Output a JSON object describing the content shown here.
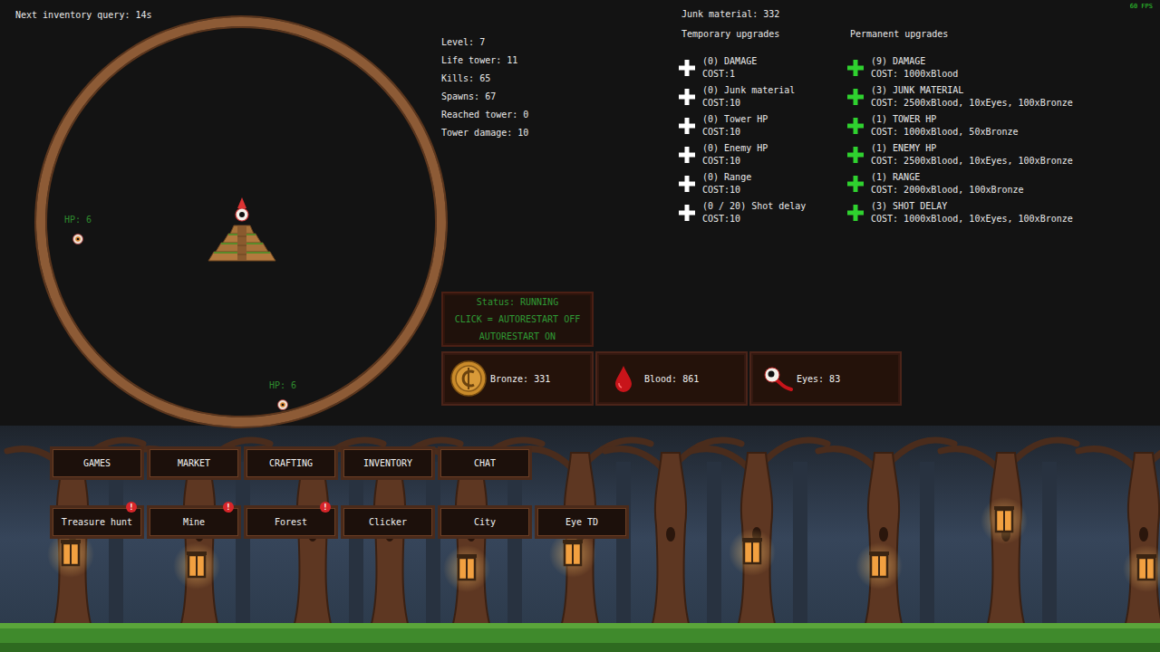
{
  "hud": {
    "inventory_query": "Next inventory query: 14s",
    "fps": "60 FPS"
  },
  "arena": {
    "enemies": [
      {
        "hp": "HP: 6"
      },
      {
        "hp": "HP: 6"
      }
    ]
  },
  "stats": [
    "Level: 7",
    "Life tower: 11",
    "Kills: 65",
    "Spawns: 67",
    "Reached tower: 0",
    "Tower damage: 10"
  ],
  "junk_material": "Junk material: 332",
  "temporary_upgrades": {
    "title": "Temporary upgrades",
    "items": [
      {
        "name": "(0) DAMAGE",
        "cost": "COST:1"
      },
      {
        "name": "(0) Junk material",
        "cost": "COST:10"
      },
      {
        "name": "(0) Tower HP",
        "cost": "COST:10"
      },
      {
        "name": "(0) Enemy HP",
        "cost": "COST:10"
      },
      {
        "name": "(0) Range",
        "cost": "COST:10"
      },
      {
        "name": "(0 / 20) Shot delay",
        "cost": "COST:10"
      }
    ]
  },
  "permanent_upgrades": {
    "title": "Permanent upgrades",
    "items": [
      {
        "name": "(9) DAMAGE",
        "cost": "COST: 1000xBlood"
      },
      {
        "name": "(3) JUNK MATERIAL",
        "cost": "COST: 2500xBlood, 10xEyes, 100xBronze"
      },
      {
        "name": "(1) TOWER HP",
        "cost": "COST: 1000xBlood, 50xBronze"
      },
      {
        "name": "(1) ENEMY HP",
        "cost": "COST: 2500xBlood, 10xEyes, 100xBronze"
      },
      {
        "name": "(1) RANGE",
        "cost": "COST: 2000xBlood, 100xBronze"
      },
      {
        "name": "(3) SHOT DELAY",
        "cost": "COST: 1000xBlood, 10xEyes, 100xBronze"
      }
    ]
  },
  "status": {
    "lines": [
      "Status: RUNNING",
      "CLICK = AUTORESTART OFF",
      "AUTORESTART ON"
    ]
  },
  "resources": [
    {
      "kind": "bronze",
      "label": "Bronze: 331"
    },
    {
      "kind": "blood",
      "label": "Blood: 861"
    },
    {
      "kind": "eyes",
      "label": "Eyes: 83"
    }
  ],
  "menu": [
    {
      "label": "GAMES",
      "selected": false
    },
    {
      "label": "MARKET",
      "selected": false
    },
    {
      "label": "CRAFTING",
      "selected": false
    },
    {
      "label": "INVENTORY",
      "selected": false
    },
    {
      "label": "CHAT",
      "selected": false
    }
  ],
  "games": [
    {
      "label": "Treasure hunt",
      "selected": false,
      "badge": "!"
    },
    {
      "label": "Mine",
      "selected": false,
      "badge": "!"
    },
    {
      "label": "Forest",
      "selected": false,
      "badge": "!"
    },
    {
      "label": "Clicker",
      "selected": false
    },
    {
      "label": "City",
      "selected": false
    },
    {
      "label": "Eye TD",
      "selected": false
    }
  ]
}
